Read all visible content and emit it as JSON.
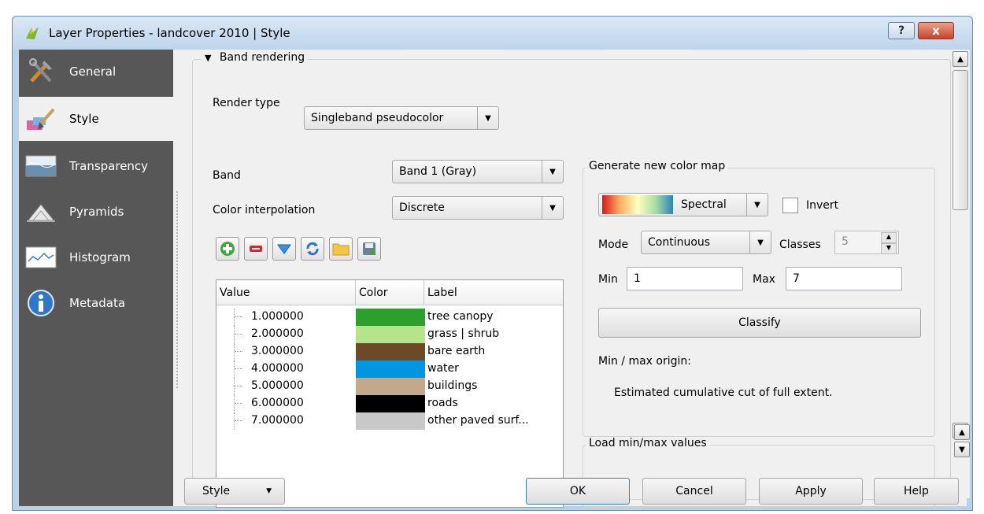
{
  "window": {
    "title": "Layer Properties - landcover 2010 | Style",
    "help_glyph": "?",
    "close_glyph": "x"
  },
  "sidebar": {
    "items": [
      {
        "label": "General",
        "icon": "tools-icon"
      },
      {
        "label": "Style",
        "icon": "paintbrush-icon",
        "active": true
      },
      {
        "label": "Transparency",
        "icon": "transparency-icon"
      },
      {
        "label": "Pyramids",
        "icon": "pyramids-icon"
      },
      {
        "label": "Histogram",
        "icon": "histogram-icon"
      },
      {
        "label": "Metadata",
        "icon": "info-icon"
      }
    ]
  },
  "band_rendering": {
    "title": "Band rendering",
    "render_type_label": "Render type",
    "render_type_value": "Singleband pseudocolor",
    "band_label": "Band",
    "band_value": "Band 1 (Gray)",
    "interp_label": "Color interpolation",
    "interp_value": "Discrete"
  },
  "table": {
    "headers": [
      "Value",
      "Color",
      "Label"
    ],
    "rows": [
      {
        "value": "1.000000",
        "color": "#2ca02c",
        "label": "tree canopy"
      },
      {
        "value": "2.000000",
        "color": "#b5e48c",
        "label": "grass | shrub"
      },
      {
        "value": "3.000000",
        "color": "#6b4a28",
        "label": "bare earth"
      },
      {
        "value": "4.000000",
        "color": "#0096e0",
        "label": "water"
      },
      {
        "value": "5.000000",
        "color": "#c4a88c",
        "label": "buildings"
      },
      {
        "value": "6.000000",
        "color": "#000000",
        "label": "roads"
      },
      {
        "value": "7.000000",
        "color": "#c8c8c8",
        "label": "other paved surf..."
      }
    ]
  },
  "color_map": {
    "title": "Generate new color map",
    "ramp_name": "Spectral",
    "invert_label": "Invert",
    "mode_label": "Mode",
    "mode_value": "Continuous",
    "classes_label": "Classes",
    "classes_value": "5",
    "min_label": "Min",
    "min_value": "1",
    "max_label": "Max",
    "max_value": "7",
    "classify_label": "Classify",
    "origin_label": "Min / max origin:",
    "origin_value": "Estimated cumulative cut of full extent."
  },
  "load_minmax": {
    "title": "Load min/max values"
  },
  "footer": {
    "style_label": "Style",
    "ok_label": "OK",
    "cancel_label": "Cancel",
    "apply_label": "Apply",
    "help_label": "Help"
  },
  "colors": {
    "sidebar_bg": "#575757",
    "title_bar": "#c7d9ee",
    "close_red": "#c8422a"
  }
}
